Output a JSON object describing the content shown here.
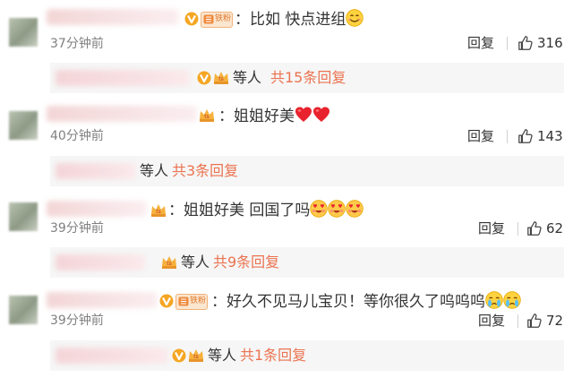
{
  "comments": [
    {
      "text": "：比如 快点进组",
      "fan_badge": "铁粉",
      "time": "37分钟前",
      "reply_label": "回复",
      "likes": "316",
      "emoji": [
        "smile-emoji"
      ],
      "replies": {
        "others": "等人",
        "total": "共15条回复"
      }
    },
    {
      "text": "：姐姐好美",
      "time": "40分钟前",
      "reply_label": "回复",
      "likes": "143",
      "emoji": [
        "red-heart-emoji",
        "red-heart-emoji"
      ],
      "replies": {
        "others": "等人",
        "total": "共3条回复"
      }
    },
    {
      "text": "：姐姐好美 回国了吗",
      "time": "39分钟前",
      "reply_label": "回复",
      "likes": "62",
      "emoji": [
        "heart-eyes-emoji",
        "heart-eyes-emoji",
        "heart-eyes-emoji"
      ],
      "replies": {
        "others": "等人",
        "total": "共9条回复"
      }
    },
    {
      "text": "：好久不见马儿宝贝！等你很久了呜呜呜",
      "fan_badge": "铁粉",
      "time": "39分钟前",
      "reply_label": "回复",
      "likes": "72",
      "emoji": [
        "crying-emoji",
        "crying-emoji"
      ],
      "replies": {
        "others": "等人",
        "total": "共1条回复"
      }
    }
  ],
  "colors": {
    "link_orange": "#eb7350",
    "badge_orange": "#f0b27a",
    "reply_bar_bg": "#f6f6f6"
  }
}
